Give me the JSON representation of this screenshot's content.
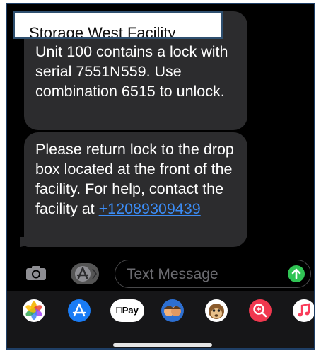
{
  "header": {
    "title": "Storage West Facility"
  },
  "messages": [
    {
      "text": "Unit 100 contains a lock with serial 7551N559. Use combination 6515 to unlock."
    },
    {
      "text": "Please return lock to the drop box located at the front of the facility. For help, contact the facility at ",
      "link": "+12089309439"
    }
  ],
  "composer": {
    "placeholder": "Text Message"
  },
  "icons": {
    "camera": "camera-icon",
    "appstore": "app-store-icon",
    "send": "send-arrow-icon"
  },
  "drawer_apps": [
    {
      "name": "photos-icon"
    },
    {
      "name": "app-store-icon"
    },
    {
      "name": "apple-pay-icon",
      "label": "Pay"
    },
    {
      "name": "memoji-icon"
    },
    {
      "name": "animoji-icon"
    },
    {
      "name": "image-search-icon"
    },
    {
      "name": "music-icon"
    }
  ],
  "colors": {
    "bubble": "#2c2c2e",
    "link": "#3b8cf5",
    "send": "#30c454",
    "background": "#000000"
  }
}
